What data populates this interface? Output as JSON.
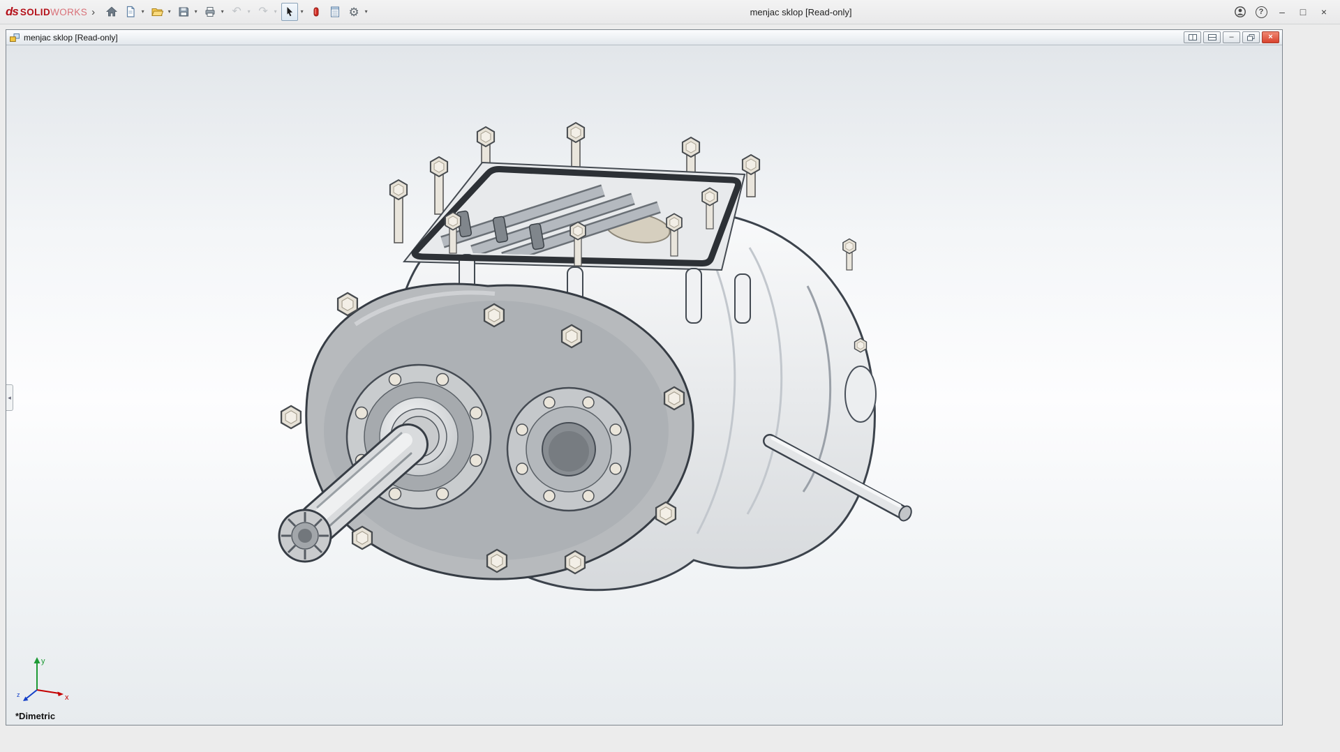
{
  "app": {
    "title": "menjac sklop [Read-only]",
    "brand": {
      "ds": "ds",
      "solid": "SOLID",
      "works": "WORKS",
      "color": "#b5121b"
    },
    "icons": {
      "expand_arrow": "›",
      "dropdown": "▾",
      "undo": "↶",
      "redo": "↷",
      "gear": "⚙",
      "help": "?",
      "minimize": "–",
      "maximize": "□",
      "close": "×"
    }
  },
  "document_window": {
    "title": "menjac sklop [Read-only]",
    "icons": {
      "minimize": "–",
      "close": "×"
    }
  },
  "viewport": {
    "view_label": "*Dimetric",
    "triad": {
      "x": "x",
      "y": "y",
      "z": "z"
    },
    "axis_colors": {
      "x": "#c40000",
      "y": "#1d9a35",
      "z": "#1440c8"
    }
  }
}
